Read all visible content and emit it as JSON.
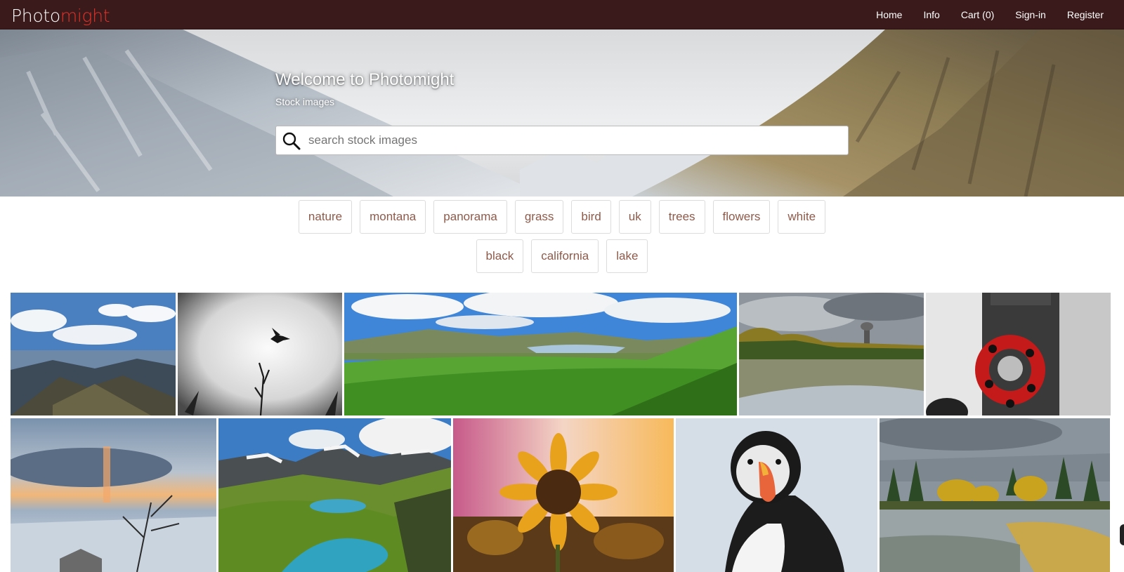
{
  "brand": {
    "part1": "Photo",
    "part2": "might",
    "accent_color": "#e2332a"
  },
  "nav": {
    "home": "Home",
    "info": "Info",
    "cart": "Cart (0)",
    "signin": "Sign-in",
    "register": "Register"
  },
  "hero": {
    "title": "Welcome to Photomight",
    "subtitle": "Stock images",
    "search_placeholder": "search stock images",
    "search_icon": "magnifier-icon"
  },
  "tags": {
    "row1": [
      "nature",
      "montana",
      "panorama",
      "grass",
      "bird",
      "uk",
      "trees",
      "flowers",
      "white"
    ],
    "row2": [
      "black",
      "california",
      "lake"
    ]
  },
  "gallery": {
    "images": [
      {
        "subject": "mountain-sky"
      },
      {
        "subject": "hummingbird"
      },
      {
        "subject": "lake-valley"
      },
      {
        "subject": "river-autumn"
      },
      {
        "subject": "poppy-wreath"
      },
      {
        "subject": "sunset-snow"
      },
      {
        "subject": "alpine-lake"
      },
      {
        "subject": "sunflower"
      },
      {
        "subject": "puffin"
      },
      {
        "subject": "forest-river"
      }
    ]
  },
  "colors": {
    "topbar": "#3a1a1a",
    "tag_text": "#8e5a4a",
    "tag_border": "#dcdcdc"
  }
}
